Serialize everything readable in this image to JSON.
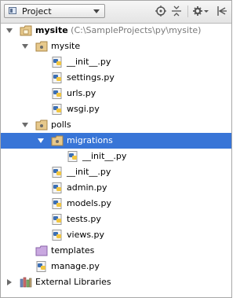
{
  "toolbar": {
    "view_label": "Project",
    "icons": [
      "scroll-from-source-icon",
      "collapse-all-icon",
      "settings-icon",
      "hide-panel-icon"
    ]
  },
  "tree": {
    "root": {
      "name": "mysite",
      "path": "(C:\\SampleProjects\\py\\mysite)"
    },
    "mysite_pkg": {
      "label": "mysite",
      "files": [
        "__init__.py",
        "settings.py",
        "urls.py",
        "wsgi.py"
      ]
    },
    "polls_pkg": {
      "label": "polls",
      "migrations": {
        "label": "migrations",
        "files": [
          "__init__.py"
        ]
      },
      "files": [
        "__init__.py",
        "admin.py",
        "models.py",
        "tests.py",
        "views.py"
      ]
    },
    "templates_label": "templates",
    "manage_label": "manage.py",
    "external_label": "External Libraries"
  },
  "colors": {
    "selection": "#3875d7",
    "folder": "#c9a46a",
    "python_blue": "#3c6fb4",
    "python_yellow": "#f2c640"
  }
}
